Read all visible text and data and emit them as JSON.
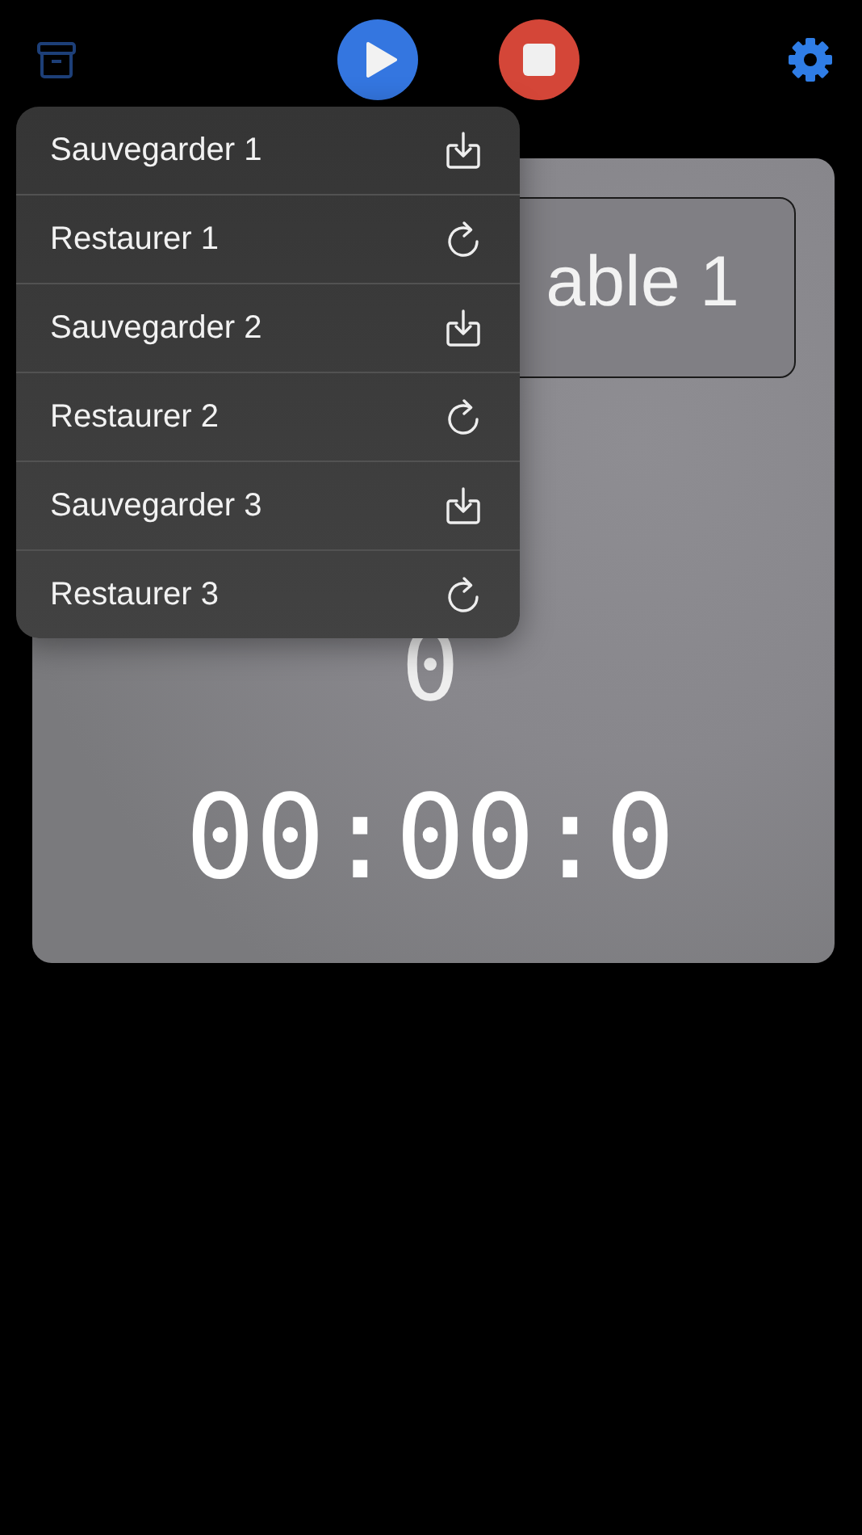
{
  "toolbar": {
    "play_button": {
      "kind": "play"
    },
    "stop_button": {
      "kind": "stop"
    }
  },
  "counter_card": {
    "name_button": "able 1",
    "count": "0",
    "timer": "00:00:0"
  },
  "menu": [
    {
      "label": "Sauvegarder 1",
      "kind": "save"
    },
    {
      "label": "Restaurer 1",
      "kind": "restore"
    },
    {
      "label": "Sauvegarder 2",
      "kind": "save"
    },
    {
      "label": "Restaurer 2",
      "kind": "restore"
    },
    {
      "label": "Sauvegarder 3",
      "kind": "save"
    },
    {
      "label": "Restaurer 3",
      "kind": "restore"
    }
  ]
}
